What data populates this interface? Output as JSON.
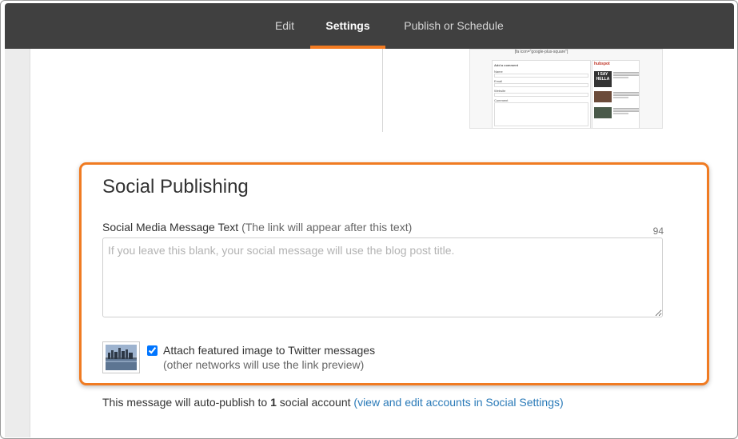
{
  "nav": {
    "tabs": [
      {
        "label": "Edit",
        "active": false
      },
      {
        "label": "Settings",
        "active": true
      },
      {
        "label": "Publish or Schedule",
        "active": false
      }
    ],
    "accent_color": "#f37b21",
    "bar_color": "#404040"
  },
  "preview": {
    "shortcode": "[fa icon=\"google-plus-square\"]",
    "form_title": "Add a comment",
    "form_labels": [
      "Name",
      "Email",
      "Website",
      "Comment"
    ],
    "sidebar_logo": "hubspot",
    "sidebar_thumb_text": "I SAY HELLA"
  },
  "social": {
    "title": "Social Publishing",
    "message_label": "Social Media Message Text",
    "message_hint": "(The link will appear after this text)",
    "char_count": "94",
    "message_value": "",
    "message_placeholder": "If you leave this blank, your social message will use the blog post title.",
    "attach_image_checked": true,
    "attach_label": "Attach featured image to Twitter messages",
    "attach_sub": "(other networks will use the link preview)",
    "highlight_color": "#f07b22"
  },
  "footer": {
    "prefix": "This message will auto-publish to",
    "count": "1",
    "suffix": "social account",
    "link_text": "(view and edit accounts in Social Settings)",
    "link_color": "#2a7ab8"
  }
}
